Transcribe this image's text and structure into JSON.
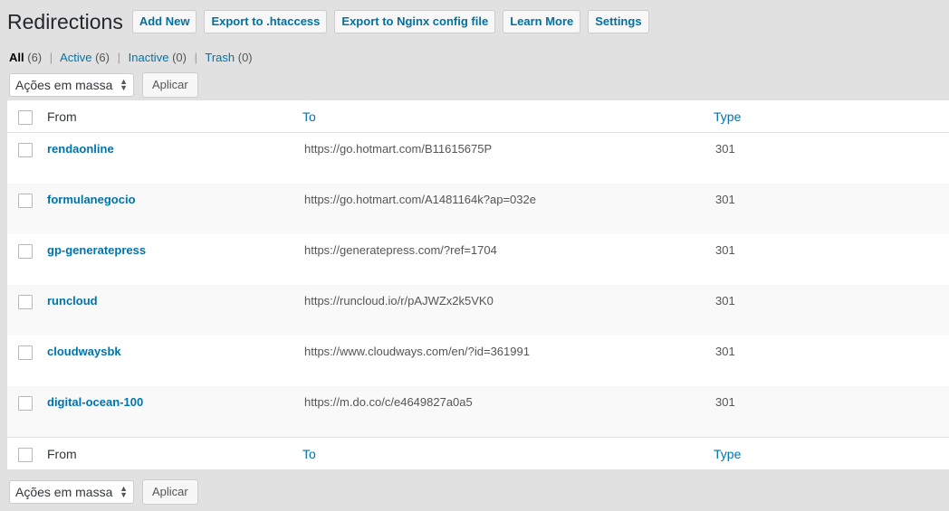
{
  "header": {
    "title": "Redirections",
    "buttons": [
      "Add New",
      "Export to .htaccess",
      "Export to Nginx config file",
      "Learn More",
      "Settings"
    ]
  },
  "filters": [
    {
      "label": "All",
      "count": "(6)",
      "current": true
    },
    {
      "label": "Active",
      "count": "(6)"
    },
    {
      "label": "Inactive",
      "count": "(0)"
    },
    {
      "label": "Trash",
      "count": "(0)"
    }
  ],
  "bulk": {
    "selected": "Ações em massa",
    "apply_label": "Aplicar"
  },
  "table": {
    "columns": [
      "From",
      "To",
      "Type"
    ],
    "rows": [
      {
        "from": "rendaonline",
        "to": "https://go.hotmart.com/B11615675P",
        "code": "301"
      },
      {
        "from": "formulanegocio",
        "to": "https://go.hotmart.com/A1481164k?ap=032e",
        "code": "301"
      },
      {
        "from": "gp-generatepress",
        "to": "https://generatepress.com/?ref=1704",
        "code": "301"
      },
      {
        "from": "runcloud",
        "to": "https://runcloud.io/r/pAJWZx2k5VK0",
        "code": "301"
      },
      {
        "from": "cloudwaysbk",
        "to": "https://www.cloudways.com/en/?id=361991",
        "code": "301"
      },
      {
        "from": "digital-ocean-100",
        "to": "https://m.do.co/c/e4649827a0a5",
        "code": "301"
      }
    ]
  }
}
